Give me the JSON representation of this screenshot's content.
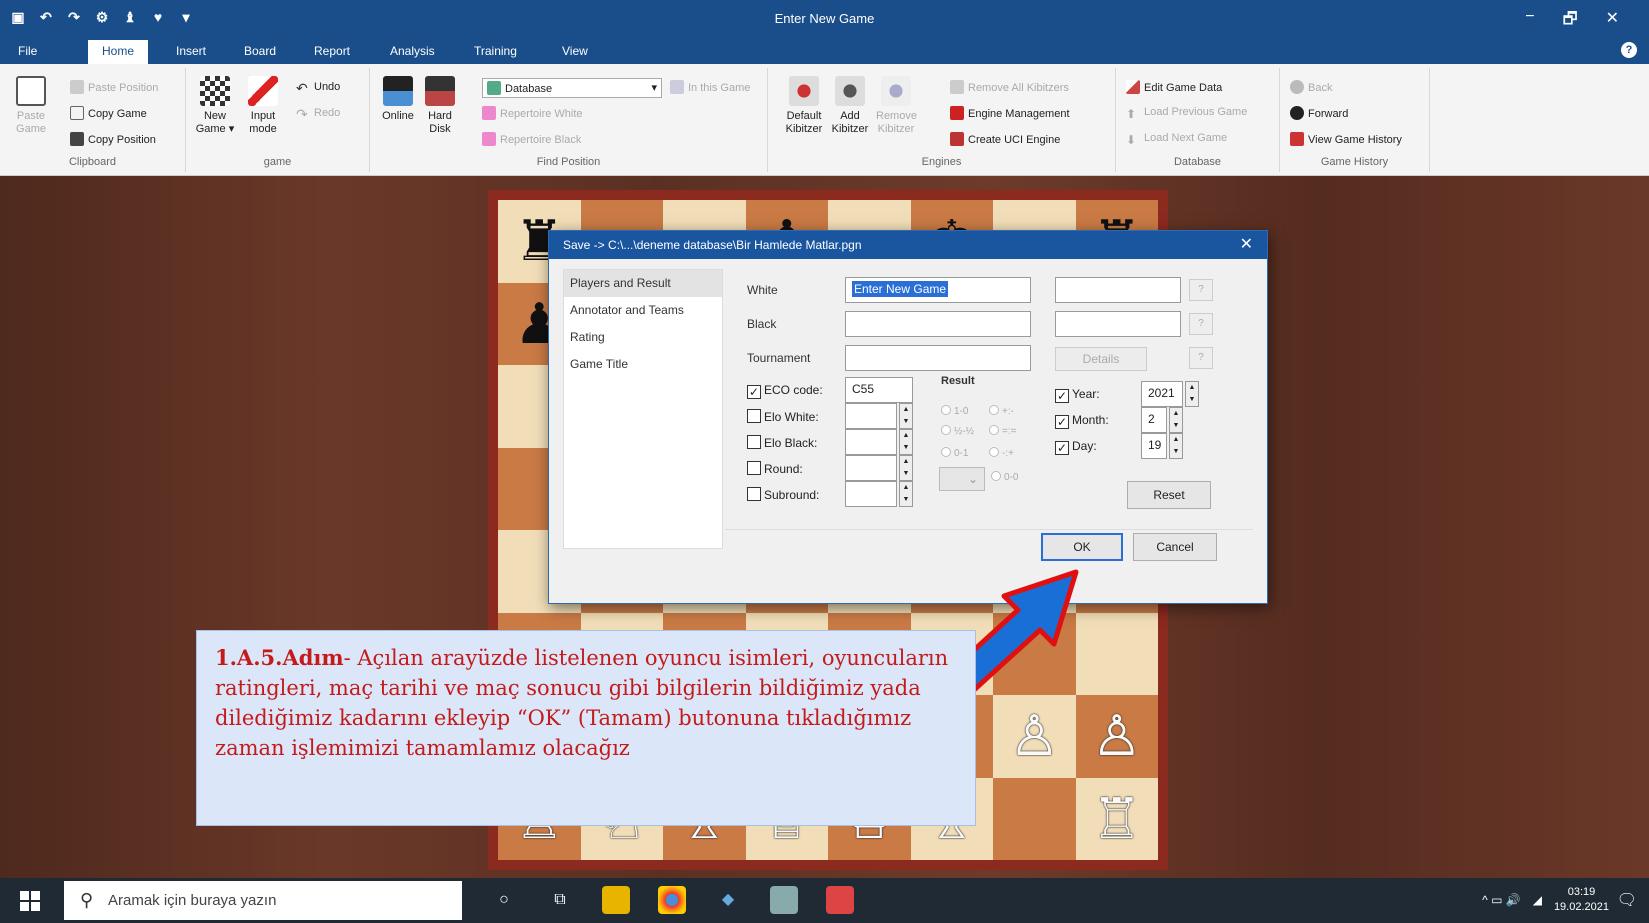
{
  "window": {
    "title": "Enter New Game",
    "controls": [
      "−",
      "🗗",
      "✕"
    ]
  },
  "quick_access": [
    "▣",
    "↶",
    "↷",
    "⚙",
    "♝",
    "♥",
    "▾"
  ],
  "menu": {
    "tabs": [
      "File",
      "Home",
      "Insert",
      "Board",
      "Report",
      "Analysis",
      "Training",
      "View"
    ],
    "active": "Home",
    "help": "?"
  },
  "ribbon": {
    "clipboard": {
      "label": "Clipboard",
      "paste": "Paste Game",
      "paste_position": "Paste Position",
      "copy_game": "Copy Game",
      "copy_position": "Copy Position"
    },
    "game": {
      "label": "game",
      "new_game": "New Game ▾",
      "input_mode": "Input mode",
      "undo": "Undo",
      "redo": "Redo"
    },
    "find": {
      "label": "Find Position",
      "online": "Online",
      "hard_disk": "Hard Disk",
      "database": "Database",
      "in_this_game": "In this Game",
      "rep_white": "Repertoire White",
      "rep_black": "Repertoire Black"
    },
    "engines": {
      "label": "Engines",
      "default_kibitzer": "Default Kibitzer",
      "add_kibitzer": "Add Kibitzer",
      "remove_kibitzer": "Remove Kibitzer",
      "remove_all": "Remove All Kibitzers",
      "engine_mgmt": "Engine Management",
      "create_uci": "Create UCI Engine"
    },
    "database": {
      "label": "Database",
      "edit_game_data": "Edit Game Data",
      "load_prev": "Load Previous Game",
      "load_next": "Load Next Game"
    },
    "history": {
      "label": "Game History",
      "back": "Back",
      "forward": "Forward",
      "view_history": "View Game History"
    }
  },
  "dialog": {
    "title": "Save -> C:\\...\\deneme database\\Bir Hamlede Matlar.pgn",
    "nav": [
      "Players and Result",
      "Annotator and Teams",
      "Rating",
      "Game Title"
    ],
    "labels": {
      "white": "White",
      "black": "Black",
      "tournament": "Tournament",
      "details": "Details",
      "result": "Result"
    },
    "white_value": "Enter New Game",
    "checks": [
      {
        "label": "ECO code:",
        "checked": true,
        "value": "C55"
      },
      {
        "label": "Elo White:",
        "checked": false,
        "value": ""
      },
      {
        "label": "Elo Black:",
        "checked": false,
        "value": ""
      },
      {
        "label": "Round:",
        "checked": false,
        "value": ""
      },
      {
        "label": "Subround:",
        "checked": false,
        "value": ""
      }
    ],
    "results": [
      "1-0",
      "+:-",
      "½-½",
      "=:=",
      "0-1",
      "-:+",
      "0-0"
    ],
    "date": [
      {
        "label": "Year:",
        "value": "2021",
        "checked": true
      },
      {
        "label": "Month:",
        "value": "2",
        "checked": true
      },
      {
        "label": "Day:",
        "value": "19",
        "checked": true
      }
    ],
    "reset": "Reset",
    "ok": "OK",
    "cancel": "Cancel"
  },
  "callout": {
    "step": "1.A.5.Adım",
    "text": "- Açılan arayüzde listelenen oyuncu isimleri, oyuncuların ratingleri, maç tarihi ve maç sonucu gibi bilgilerin bildiğimiz yada dilediğimiz kadarını ekleyip “OK” (Tamam) butonuna tıkladığımız zaman işlemimizi tamamlamız olacağız"
  },
  "board": {
    "pieces": [
      [
        "♜",
        "",
        "",
        "♝",
        "",
        "♚",
        "",
        "♜"
      ],
      [
        "♟",
        "",
        "",
        "",
        "",
        "",
        "",
        ""
      ],
      [
        "",
        "",
        "",
        "",
        "",
        "",
        "",
        ""
      ],
      [
        "",
        "",
        "",
        "",
        "",
        "",
        "",
        ""
      ],
      [
        "",
        "",
        "",
        "",
        "",
        "",
        "",
        ""
      ],
      [
        "",
        "",
        "",
        "",
        "",
        "♘",
        "",
        ""
      ],
      [
        "",
        "",
        "",
        "",
        "",
        "",
        "♙",
        "♙"
      ],
      [
        "♖",
        "♘",
        "♗",
        "♕",
        "♔",
        "♗",
        "",
        "♖"
      ]
    ]
  },
  "taskbar": {
    "search_placeholder": "Aramak için buraya yazın",
    "time": "03:19",
    "date": "19.02.2021",
    "tray": "^ ▭ 🔊"
  },
  "colors": {
    "accent": "#1a4e8a",
    "callout_text": "#c41a1a",
    "arrow_fill": "#1a6fd6",
    "arrow_stroke": "#e01010"
  }
}
